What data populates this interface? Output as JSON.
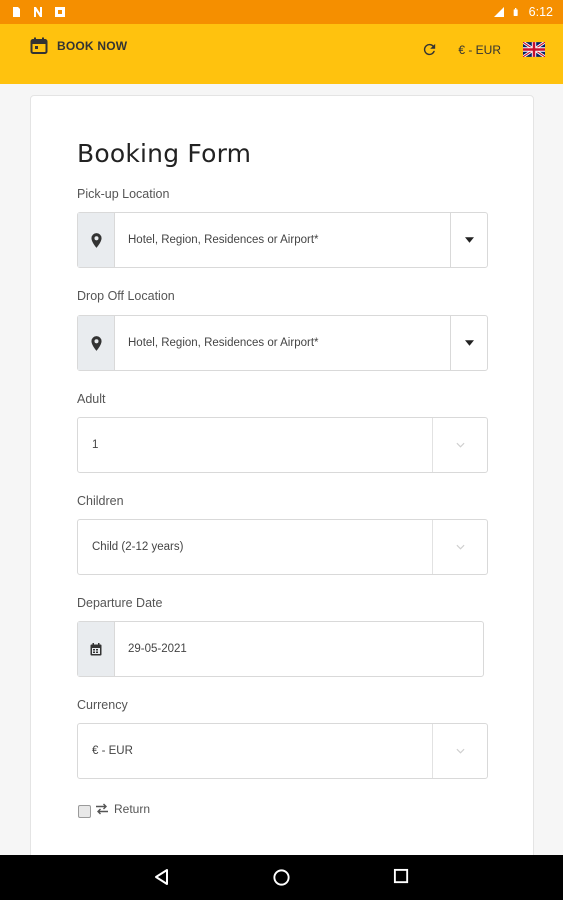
{
  "status_bar": {
    "time": "6:12",
    "icons": [
      "sim-card-icon",
      "n-icon",
      "square-icon",
      "signal-icon",
      "battery-icon"
    ],
    "background": "#f58f00"
  },
  "app_bar": {
    "book_now_label": "BOOK NOW",
    "currency_label": "€ - EUR",
    "icons": [
      "calendar-icon",
      "refresh-icon",
      "uk-flag-icon"
    ],
    "background": "#ffc20e"
  },
  "form": {
    "title": "Booking Form",
    "pickup": {
      "label": "Pick-up Location",
      "placeholder": "Hotel, Region, Residences or Airport*"
    },
    "dropoff": {
      "label": "Drop Off Location",
      "placeholder": "Hotel, Region, Residences or Airport*"
    },
    "adult": {
      "label": "Adult",
      "value": "1"
    },
    "children": {
      "label": "Children",
      "value": "Child (2-12 years)"
    },
    "departure": {
      "label": "Departure Date",
      "value": "29-05-2021"
    },
    "currency": {
      "label": "Currency",
      "value": "€ - EUR"
    },
    "return": {
      "label": "Return",
      "checked": false
    }
  },
  "nav_bar": {
    "icons": [
      "back-icon",
      "home-icon",
      "recents-icon"
    ]
  }
}
